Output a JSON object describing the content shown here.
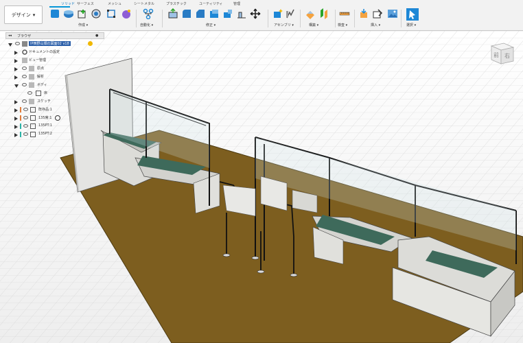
{
  "app": {
    "workspace_label": "デザイン"
  },
  "tabs": [
    "ソリッド",
    "サーフェス",
    "メッシュ",
    "シートメタル",
    "プラスチック",
    "ユーティリティ",
    "管理"
  ],
  "active_tab": "ソリッド",
  "groups": {
    "create": "作成",
    "automate": "自動化",
    "modify": "修正",
    "assemble": "アセンブリ",
    "construct": "構築",
    "inspect": "検査",
    "insert": "挿入",
    "select": "選択"
  },
  "browser": {
    "title": "ブラウザ",
    "root": "IP西野山畑の図面02 v18",
    "items": [
      {
        "label": "ドキュメントの設定",
        "icon": "gear-icon",
        "expanded": false,
        "color": ""
      },
      {
        "label": "ビュー管理",
        "icon": "folder-icon",
        "expanded": false,
        "color": ""
      },
      {
        "label": "原点",
        "icon": "folder-icon",
        "expanded": false,
        "color": ""
      },
      {
        "label": "解析",
        "icon": "folder-icon",
        "expanded": false,
        "color": ""
      },
      {
        "label": "ボディ",
        "icon": "folder-icon",
        "expanded": true,
        "color": ""
      },
      {
        "label": "床",
        "icon": "body-icon",
        "expanded": false,
        "color": ""
      },
      {
        "label": "スケッチ",
        "icon": "folder-icon",
        "expanded": false,
        "color": ""
      },
      {
        "label": "既存品:1",
        "icon": "component-icon",
        "expanded": false,
        "color": "#e07b39"
      },
      {
        "label": "135席:1",
        "icon": "component-icon",
        "expanded": false,
        "color": "#e07b39"
      },
      {
        "label": "135PT:1",
        "icon": "component-icon",
        "expanded": false,
        "color": "#2bb3a6"
      },
      {
        "label": "135PT:2",
        "icon": "component-icon",
        "expanded": false,
        "color": "#2bb3a6"
      }
    ]
  },
  "viewcube": {
    "front": "前",
    "right": "右"
  },
  "colors": {
    "floor": "#7a5c1e",
    "accent": "#0696d7",
    "desk_top": "#3e6b5c"
  }
}
